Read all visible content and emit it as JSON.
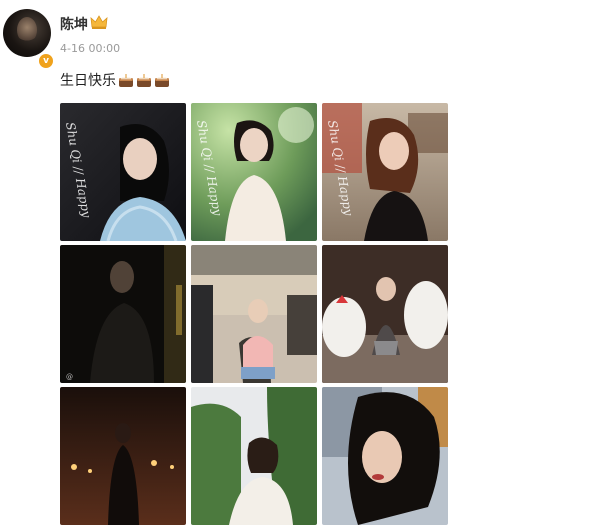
{
  "post": {
    "username": "陈坤",
    "timestamp": "4-16 00:00",
    "text": "生日快乐",
    "emoji": [
      "cake-icon",
      "cake-icon",
      "cake-icon"
    ]
  },
  "photos": [
    {
      "id": "photo-1",
      "caption": "Shu Qi // Happy"
    },
    {
      "id": "photo-2",
      "caption": "Shu Qi // Happy"
    },
    {
      "id": "photo-3",
      "caption": "Shu Qi // Happy"
    },
    {
      "id": "photo-4",
      "caption": ""
    },
    {
      "id": "photo-5",
      "caption": ""
    },
    {
      "id": "photo-6",
      "caption": ""
    },
    {
      "id": "photo-7",
      "caption": ""
    },
    {
      "id": "photo-8",
      "caption": ""
    },
    {
      "id": "photo-9",
      "caption": ""
    }
  ],
  "colors": {
    "verified_badge": "#f0a21c",
    "crown": "#f5b73b",
    "timestamp": "#9a9a9a"
  }
}
